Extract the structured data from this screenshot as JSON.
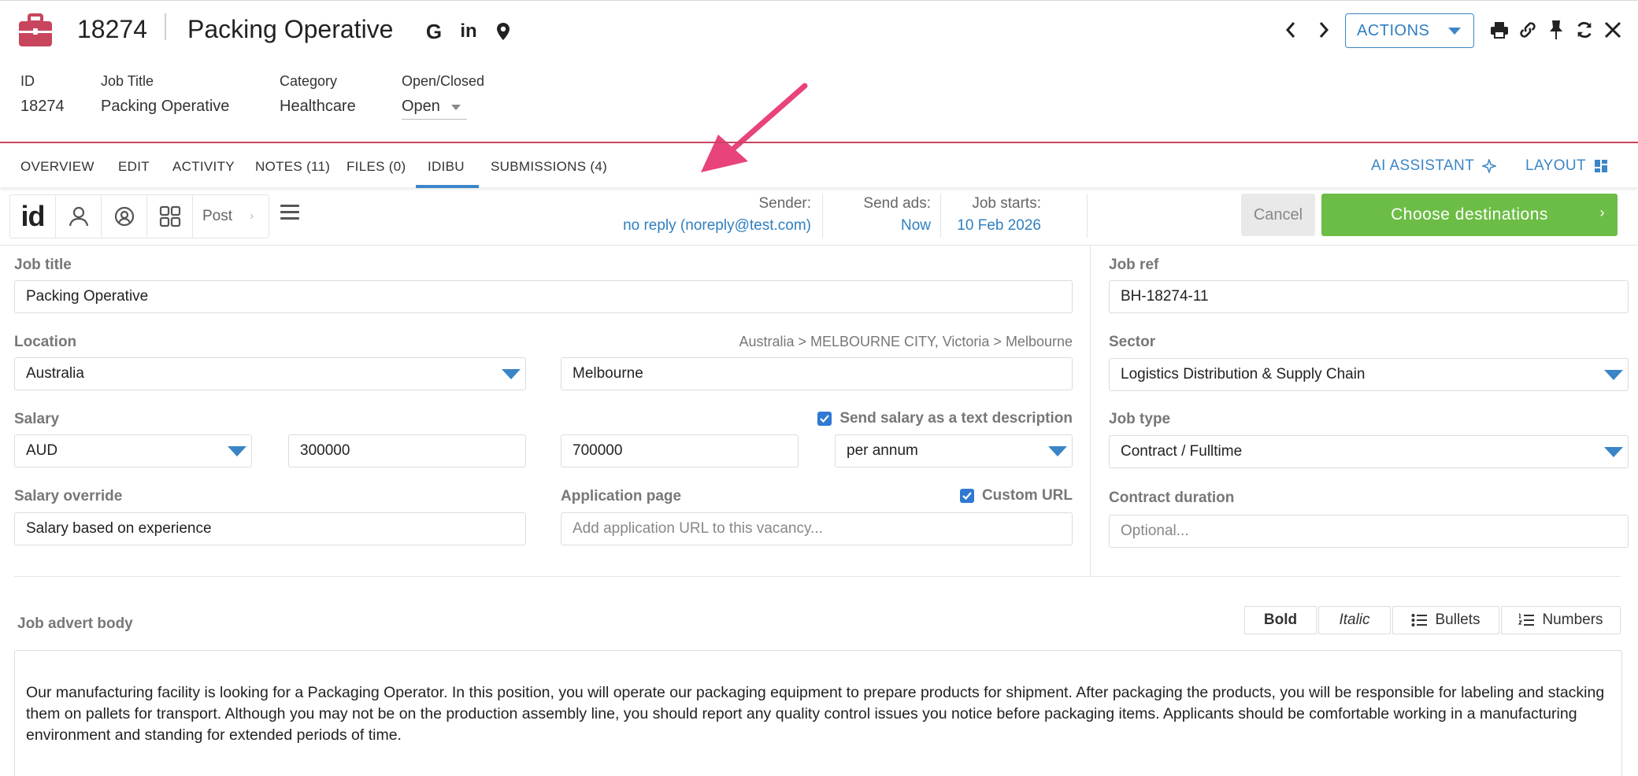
{
  "header": {
    "record_id": "18274",
    "record_title": "Packing Operative",
    "social_icons": [
      "google-icon",
      "linkedin-icon",
      "map-pin-icon"
    ],
    "actions_label": "ACTIONS",
    "tool_icons": [
      "print-icon",
      "link-icon",
      "pin-icon",
      "refresh-icon",
      "close-icon"
    ]
  },
  "summary": {
    "id_label": "ID",
    "id_value": "18274",
    "title_label": "Job Title",
    "title_value": "Packing Operative",
    "category_label": "Category",
    "category_value": "Healthcare",
    "status_label": "Open/Closed",
    "status_value": "Open"
  },
  "tabs": [
    {
      "label": "OVERVIEW"
    },
    {
      "label": "EDIT"
    },
    {
      "label": "ACTIVITY"
    },
    {
      "label": "NOTES (11)"
    },
    {
      "label": "FILES (0)"
    },
    {
      "label": "IDIBU"
    },
    {
      "label": "SUBMISSIONS (4)"
    }
  ],
  "active_tab": "IDIBU",
  "tab_right": {
    "ai_assistant": "AI ASSISTANT",
    "layout": "LAYOUT"
  },
  "accent_colors": {
    "brand_red": "#c8455e",
    "link_blue": "#2f7fc1",
    "go_green": "#6cbd45",
    "annotation_pink": "#e8437a"
  },
  "idibu": {
    "logo": "id",
    "post_label": "Post",
    "sender_label": "Sender:",
    "sender_value": "no reply (noreply@test.com)",
    "send_ads_label": "Send ads:",
    "send_ads_value": "Now",
    "job_starts_label": "Job starts:",
    "job_starts_value": "10 Feb 2026",
    "cancel_label": "Cancel",
    "choose_label": "Choose destinations"
  },
  "form": {
    "job_title_label": "Job title",
    "job_title_value": "Packing Operative",
    "job_ref_label": "Job ref",
    "job_ref_value": "BH-18274-11",
    "location_label": "Location",
    "location_path": "Australia > MELBOURNE CITY, Victoria > Melbourne",
    "country_value": "Australia",
    "city_value": "Melbourne",
    "sector_label": "Sector",
    "sector_value": "Logistics Distribution & Supply Chain",
    "salary_label": "Salary",
    "send_salary_text_label": "Send salary as a text description",
    "currency_value": "AUD",
    "salary_min": "300000",
    "salary_max": "700000",
    "salary_period": "per annum",
    "job_type_label": "Job type",
    "job_type_value": "Contract / Fulltime",
    "salary_override_label": "Salary override",
    "salary_override_value": "Salary based on experience",
    "application_page_label": "Application page",
    "custom_url_label": "Custom URL",
    "application_url_placeholder": "Add application URL to this vacancy...",
    "contract_duration_label": "Contract duration",
    "contract_duration_placeholder": "Optional...",
    "advert_body_label": "Job advert body",
    "format_buttons": {
      "bold": "Bold",
      "italic": "Italic",
      "bullets": "Bullets",
      "numbers": "Numbers"
    },
    "advert_body_text": "Our manufacturing facility is looking for a Packaging Operator. In this position, you will operate our packaging equipment to prepare products for shipment. After packaging the products, you will be responsible for labeling and stacking them on pallets for transport. Although you may not be on the production assembly line, you should report any quality control issues you notice before packaging items. Applicants should be comfortable working in a manufacturing environment and standing for extended periods of time."
  }
}
